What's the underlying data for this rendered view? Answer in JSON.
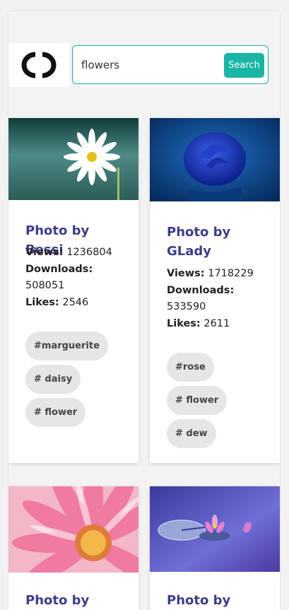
{
  "search": {
    "value": "flowers",
    "button_label": "Search"
  },
  "cards": [
    {
      "title": "Photo by Bessi",
      "views_label": "Views:",
      "views": "1236804",
      "downloads_label": "Downloads:",
      "downloads": "508051",
      "likes_label": "Likes:",
      "likes": "2546",
      "tags": [
        "#marguerite",
        "# daisy",
        "# flower"
      ]
    },
    {
      "title": "Photo by GLady",
      "views_label": "Views:",
      "views": "1718229",
      "downloads_label": "Downloads:",
      "downloads": "533590",
      "likes_label": "Likes:",
      "likes": "2611",
      "tags": [
        "#rose",
        "# flower",
        "# dew"
      ]
    },
    {
      "title": "Photo by"
    },
    {
      "title": "Photo by"
    }
  ],
  "colors": {
    "accent": "#19b6a5",
    "title": "#3d3d8a"
  }
}
